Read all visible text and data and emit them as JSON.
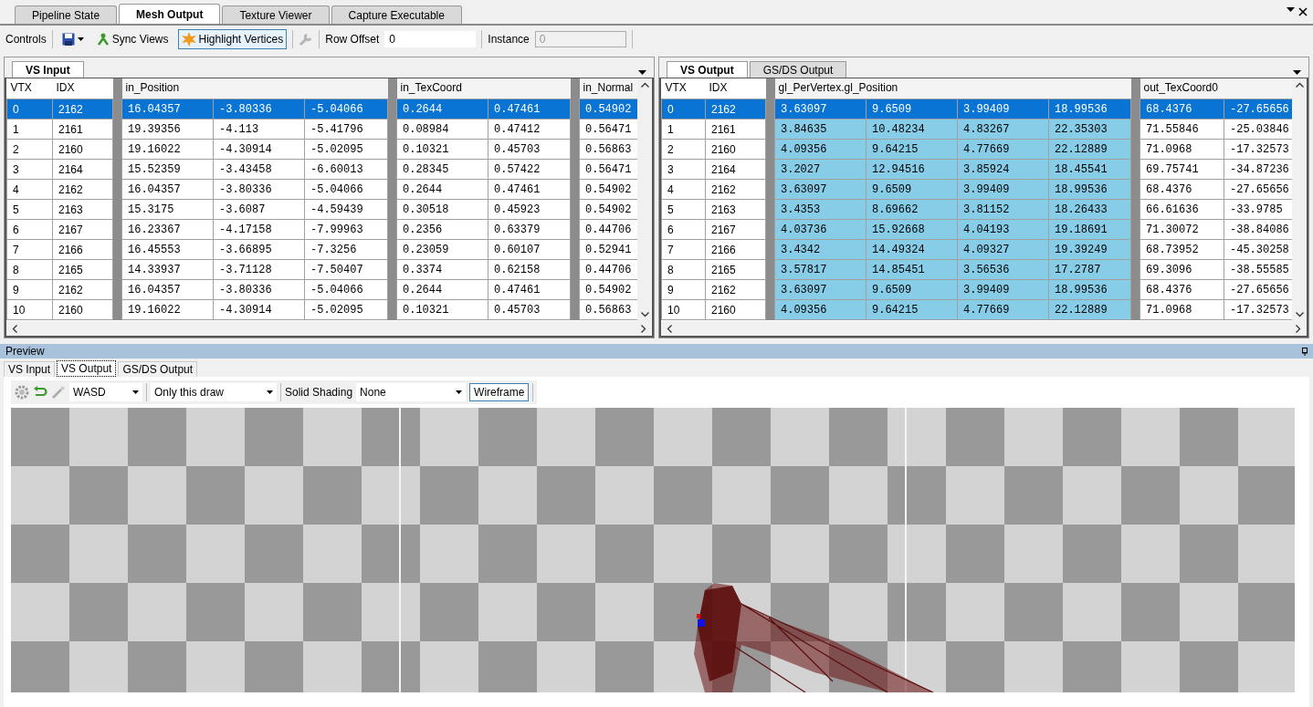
{
  "tabs": [
    {
      "label": "Pipeline State",
      "selected": false
    },
    {
      "label": "Mesh Output",
      "selected": true
    },
    {
      "label": "Texture Viewer",
      "selected": false
    },
    {
      "label": "Capture Executable",
      "selected": false
    }
  ],
  "toolbar": {
    "label": "Controls",
    "sync_views": "Sync Views",
    "highlight_vertices": {
      "label": "Highlight Vertices",
      "on": true
    },
    "row_offset": {
      "label": "Row Offset",
      "value": "0"
    },
    "instance": {
      "label": "Instance",
      "value": "0",
      "disabled": true
    }
  },
  "input_panel": {
    "tabs": [
      {
        "label": "VS Input",
        "selected": true
      }
    ],
    "fixed_columns": [
      "VTX",
      "IDX"
    ],
    "groups": [
      {
        "name": "in_Position",
        "highlighted": false
      },
      {
        "name": "in_TexCoord",
        "highlighted": false
      },
      {
        "name": "in_Normal",
        "highlighted": false
      }
    ],
    "rows": [
      {
        "vtx": "0",
        "idx": "2162",
        "values": [
          [
            "16.04357",
            "-3.80336",
            "-5.04066"
          ],
          [
            "0.2644",
            "0.47461"
          ],
          [
            "0.54902"
          ]
        ],
        "selected": true
      },
      {
        "vtx": "1",
        "idx": "2161",
        "values": [
          [
            "19.39356",
            "-4.113",
            "-5.41796"
          ],
          [
            "0.08984",
            "0.47412"
          ],
          [
            "0.56471"
          ]
        ],
        "selected": false
      },
      {
        "vtx": "2",
        "idx": "2160",
        "values": [
          [
            "19.16022",
            "-4.30914",
            "-5.02095"
          ],
          [
            "0.10321",
            "0.45703"
          ],
          [
            "0.56863"
          ]
        ],
        "selected": false
      },
      {
        "vtx": "3",
        "idx": "2164",
        "values": [
          [
            "15.52359",
            "-3.43458",
            "-6.60013"
          ],
          [
            "0.28345",
            "0.57422"
          ],
          [
            "0.56471"
          ]
        ],
        "selected": false
      },
      {
        "vtx": "4",
        "idx": "2162",
        "values": [
          [
            "16.04357",
            "-3.80336",
            "-5.04066"
          ],
          [
            "0.2644",
            "0.47461"
          ],
          [
            "0.54902"
          ]
        ],
        "selected": false
      },
      {
        "vtx": "5",
        "idx": "2163",
        "values": [
          [
            "15.3175",
            "-3.6087",
            "-4.59439"
          ],
          [
            "0.30518",
            "0.45923"
          ],
          [
            "0.54902"
          ]
        ],
        "selected": false
      },
      {
        "vtx": "6",
        "idx": "2167",
        "values": [
          [
            "16.23367",
            "-4.17158",
            "-7.99963"
          ],
          [
            "0.2356",
            "0.63379"
          ],
          [
            "0.44706"
          ]
        ],
        "selected": false
      },
      {
        "vtx": "7",
        "idx": "2166",
        "values": [
          [
            "16.45553",
            "-3.66895",
            "-7.3256"
          ],
          [
            "0.23059",
            "0.60107"
          ],
          [
            "0.52941"
          ]
        ],
        "selected": false
      },
      {
        "vtx": "8",
        "idx": "2165",
        "values": [
          [
            "14.33937",
            "-3.71128",
            "-7.50407"
          ],
          [
            "0.3374",
            "0.62158"
          ],
          [
            "0.44706"
          ]
        ],
        "selected": false
      },
      {
        "vtx": "9",
        "idx": "2162",
        "values": [
          [
            "16.04357",
            "-3.80336",
            "-5.04066"
          ],
          [
            "0.2644",
            "0.47461"
          ],
          [
            "0.54902"
          ]
        ],
        "selected": false
      },
      {
        "vtx": "10",
        "idx": "2160",
        "values": [
          [
            "19.16022",
            "-4.30914",
            "-5.02095"
          ],
          [
            "0.10321",
            "0.45703"
          ],
          [
            "0.56863"
          ]
        ],
        "selected": false
      }
    ]
  },
  "output_panel": {
    "tabs": [
      {
        "label": "VS Output",
        "selected": true
      },
      {
        "label": "GS/DS Output",
        "selected": false
      }
    ],
    "fixed_columns": [
      "VTX",
      "IDX"
    ],
    "groups": [
      {
        "name": "gl_PerVertex.gl_Position",
        "highlighted": true
      },
      {
        "name": "out_TexCoord0",
        "highlighted": false
      }
    ],
    "rows": [
      {
        "vtx": "0",
        "idx": "2162",
        "values": [
          [
            "3.63097",
            "9.6509",
            "3.99409",
            "18.99536"
          ],
          [
            "68.4376",
            "-27.65656"
          ]
        ],
        "selected": true
      },
      {
        "vtx": "1",
        "idx": "2161",
        "values": [
          [
            "3.84635",
            "10.48234",
            "4.83267",
            "22.35303"
          ],
          [
            "71.55846",
            "-25.03846"
          ]
        ],
        "selected": false
      },
      {
        "vtx": "2",
        "idx": "2160",
        "values": [
          [
            "4.09356",
            "9.64215",
            "4.77669",
            "22.12889"
          ],
          [
            "71.0968",
            "-17.32573"
          ]
        ],
        "selected": false
      },
      {
        "vtx": "3",
        "idx": "2164",
        "values": [
          [
            "3.2027",
            "12.94516",
            "3.85924",
            "18.45541"
          ],
          [
            "69.75741",
            "-34.87236"
          ]
        ],
        "selected": false
      },
      {
        "vtx": "4",
        "idx": "2162",
        "values": [
          [
            "3.63097",
            "9.6509",
            "3.99409",
            "18.99536"
          ],
          [
            "68.4376",
            "-27.65656"
          ]
        ],
        "selected": false
      },
      {
        "vtx": "5",
        "idx": "2163",
        "values": [
          [
            "3.4353",
            "8.69662",
            "3.81152",
            "18.26433"
          ],
          [
            "66.61636",
            "-33.9785"
          ]
        ],
        "selected": false
      },
      {
        "vtx": "6",
        "idx": "2167",
        "values": [
          [
            "4.03736",
            "15.92668",
            "4.04193",
            "19.18691"
          ],
          [
            "71.30072",
            "-38.84086"
          ]
        ],
        "selected": false
      },
      {
        "vtx": "7",
        "idx": "2166",
        "values": [
          [
            "3.4342",
            "14.49324",
            "4.09327",
            "19.39249"
          ],
          [
            "68.73952",
            "-45.30258"
          ]
        ],
        "selected": false
      },
      {
        "vtx": "8",
        "idx": "2165",
        "values": [
          [
            "3.57817",
            "14.85451",
            "3.56536",
            "17.2787"
          ],
          [
            "69.3096",
            "-38.55585"
          ]
        ],
        "selected": false
      },
      {
        "vtx": "9",
        "idx": "2162",
        "values": [
          [
            "3.63097",
            "9.6509",
            "3.99409",
            "18.99536"
          ],
          [
            "68.4376",
            "-27.65656"
          ]
        ],
        "selected": false
      },
      {
        "vtx": "10",
        "idx": "2160",
        "values": [
          [
            "4.09356",
            "9.64215",
            "4.77669",
            "22.12889"
          ],
          [
            "71.0968",
            "-17.32573"
          ]
        ],
        "selected": false
      }
    ]
  },
  "preview": {
    "title": "Preview",
    "tabs": [
      {
        "label": "VS Input",
        "selected": false
      },
      {
        "label": "VS Output",
        "selected": true
      },
      {
        "label": "GS/DS Output",
        "selected": false
      }
    ],
    "camera": "WASD",
    "draw_range": "Only this draw",
    "shading_label": "Solid Shading",
    "shading": "None",
    "wireframe": {
      "label": "Wireframe",
      "on": true
    }
  }
}
